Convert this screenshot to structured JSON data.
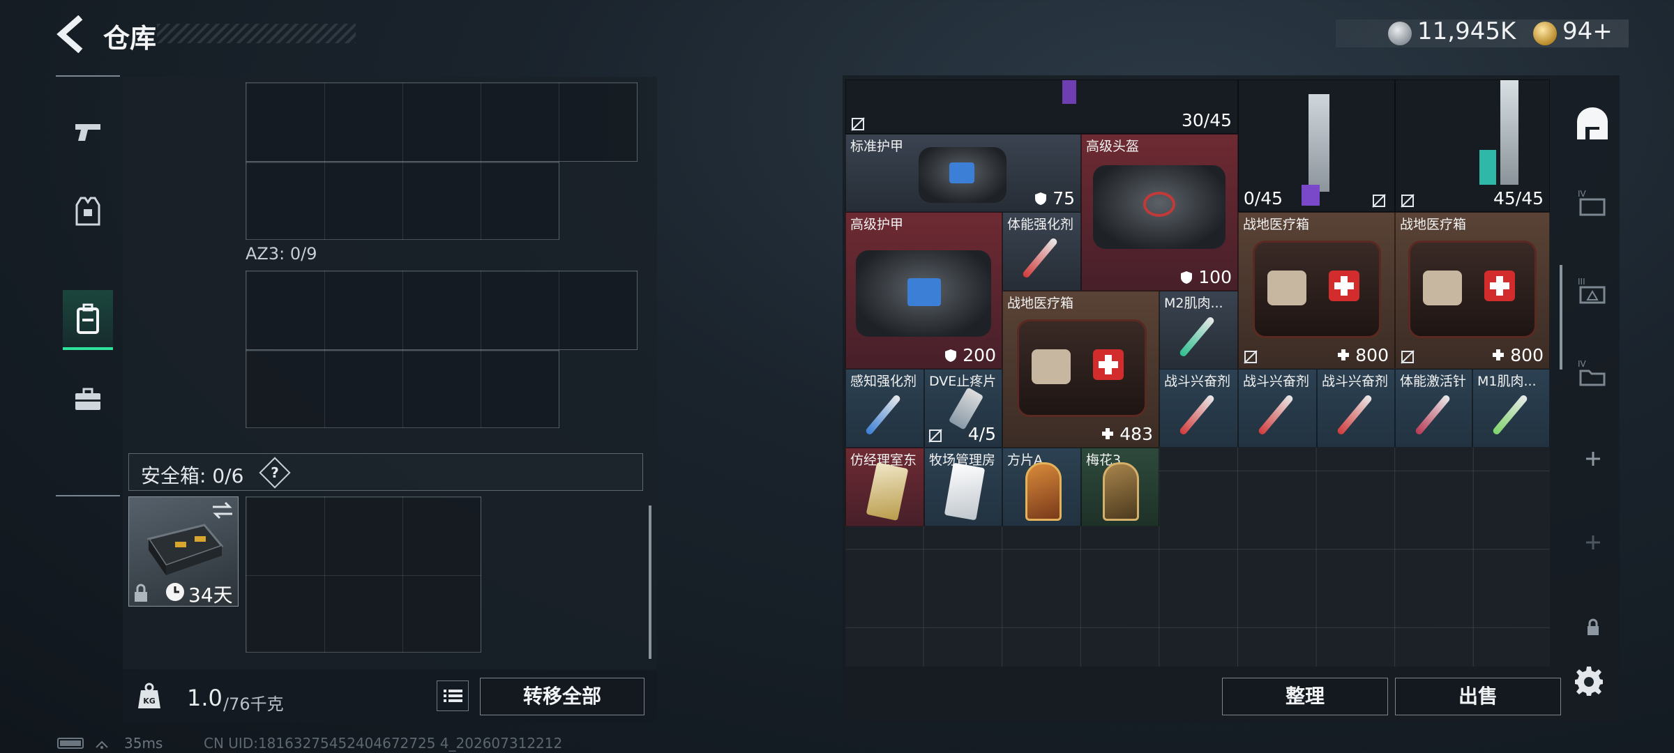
{
  "header": {
    "title": "仓库",
    "currency": {
      "silver": "11,945K",
      "gold": "94+"
    }
  },
  "left_rail": {
    "tabs": [
      {
        "icon": "pistol-icon"
      },
      {
        "icon": "armor-vest-icon"
      },
      {
        "icon": "backpack-icon",
        "active": true
      },
      {
        "icon": "briefcase-icon"
      }
    ]
  },
  "left_panel": {
    "az3_label": "AZ3: 0/9",
    "safe_box": {
      "label": "安全箱: 0/6",
      "help": "?",
      "days": "34天"
    },
    "weight": {
      "current": "1.0",
      "capacity": "/76千克"
    },
    "transfer_all_label": "转移全部"
  },
  "status": {
    "ping": "35ms",
    "uid": "CN UID:18163275452404672725 4_202607312212"
  },
  "storage": {
    "top_count_left": "30/45",
    "items": [
      {
        "name": "标准护甲",
        "value": "75",
        "value_icon": "shield"
      },
      {
        "name": "高级头盔",
        "value": "100",
        "value_icon": "shield"
      },
      {
        "name": "",
        "value": "0/45",
        "value_icon": "no-mag"
      },
      {
        "name": "",
        "value": "45/45",
        "value_icon": "no-mag"
      },
      {
        "name": "高级护甲",
        "value": "200",
        "value_icon": "shield"
      },
      {
        "name": "体能强化剂",
        "value": ""
      },
      {
        "name": "战地医疗箱",
        "value": "800",
        "value_icon": "plus"
      },
      {
        "name": "战地医疗箱",
        "value": "800",
        "value_icon": "plus"
      },
      {
        "name": "战地医疗箱",
        "value": "483",
        "value_icon": "plus"
      },
      {
        "name": "M2肌肉...",
        "value": ""
      },
      {
        "name": "感知强化剂",
        "value": ""
      },
      {
        "name": "DVE止疼片",
        "value": "4/5",
        "value_icon": "no-mag"
      },
      {
        "name": "战斗兴奋剂",
        "value": ""
      },
      {
        "name": "战斗兴奋剂",
        "value": ""
      },
      {
        "name": "战斗兴奋剂",
        "value": ""
      },
      {
        "name": "体能激活针",
        "value": ""
      },
      {
        "name": "M1肌肉...",
        "value": ""
      },
      {
        "name": "仿经理室东",
        "value": ""
      },
      {
        "name": "牧场管理房",
        "value": ""
      },
      {
        "name": "方片A",
        "value": ""
      },
      {
        "name": "梅花3",
        "value": ""
      }
    ]
  },
  "actions": {
    "sort_label": "整理",
    "sell_label": "出售"
  },
  "colors": {
    "accent_green": "#2fe39c",
    "rarity_red": "#6e2a32",
    "rarity_gold": "#5a4336",
    "rarity_blue": "#2c4152",
    "rarity_purple": "#3a4350"
  }
}
